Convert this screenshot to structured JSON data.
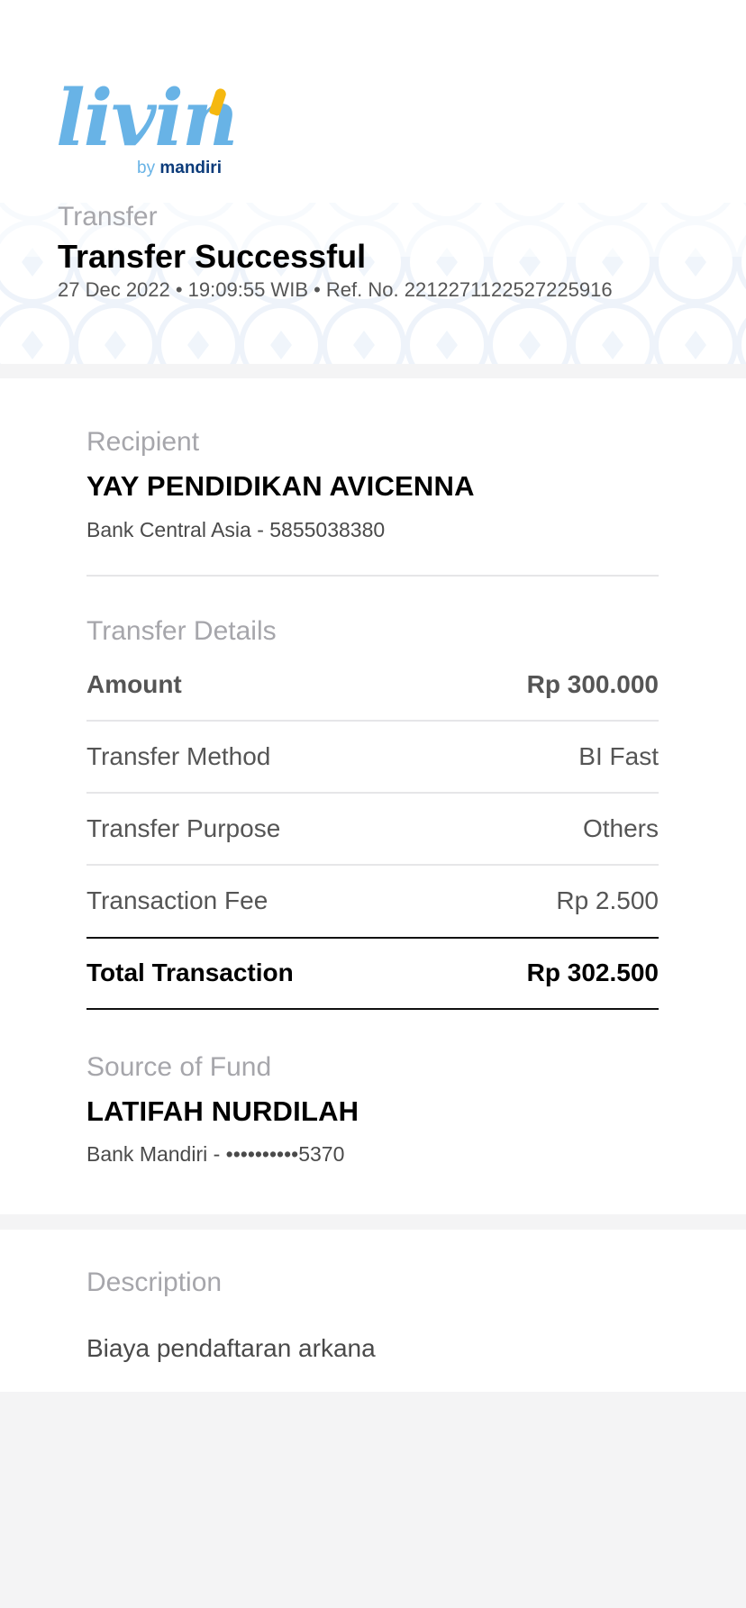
{
  "brand": {
    "logo_word": "livin",
    "by": "by",
    "bank": "mandiri"
  },
  "header": {
    "category": "Transfer",
    "title": "Transfer Successful",
    "meta": "27 Dec 2022 • 19:09:55 WIB • Ref. No. 2212271122527225916"
  },
  "recipient": {
    "label": "Recipient",
    "name": "YAY PENDIDIKAN AVICENNA",
    "account": "Bank Central Asia - 5855038380"
  },
  "transfer_details": {
    "label": "Transfer Details",
    "rows": [
      {
        "key": "Amount",
        "value": "Rp 300.000"
      },
      {
        "key": "Transfer Method",
        "value": "BI Fast"
      },
      {
        "key": "Transfer Purpose",
        "value": "Others"
      },
      {
        "key": "Transaction Fee",
        "value": "Rp 2.500"
      }
    ],
    "total": {
      "key": "Total Transaction",
      "value": "Rp 302.500"
    }
  },
  "source": {
    "label": "Source of Fund",
    "name": "LATIFAH NURDILAH",
    "account": "Bank Mandiri - ••••••••••5370"
  },
  "description": {
    "label": "Description",
    "text": "Biaya pendaftaran arkana"
  },
  "colors": {
    "logo_blue": "#68b3e6",
    "logo_accent": "#f5b80f",
    "mandiri_navy": "#0b3b7a",
    "muted_label": "#a6a6ab"
  }
}
